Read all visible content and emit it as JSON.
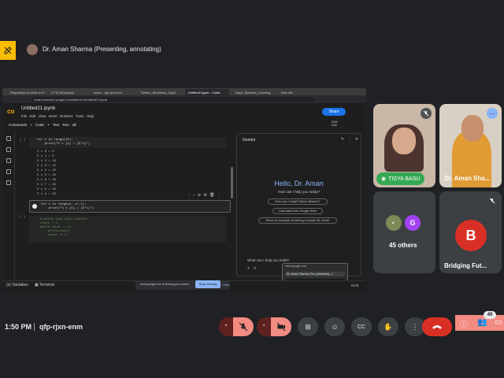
{
  "presenter": {
    "label": "Dr. Aman Sharma (Presenting, annotating)"
  },
  "browser": {
    "tabs": [
      "Regarding no news re th",
      "(774) WhatsApp",
      "Inbox - qfp-rjxn-enm",
      "Python_Workshop_Day1",
      "Untitled2.ipynb - Colab",
      "Day2_Machine_Learning",
      "New tab"
    ],
    "url": "colab.research.google.com/#fileId=1Untitled21.ipynb"
  },
  "colab": {
    "notebook_title": "Untitled21.ipynb",
    "menu": [
      "File",
      "Edit",
      "View",
      "Insert",
      "Runtime",
      "Tools",
      "Help"
    ],
    "toolbar": [
      "Commands",
      "+ Code",
      "+ Text",
      "Run all"
    ],
    "share_label": "Share",
    "ram_label": "RAM\nDisk",
    "cells": [
      {
        "bracket": "[ ]",
        "code": "for i in range(10):\n    print(\"5 x {i} = {5*i}\")",
        "output": "5 x 0 = 0\n5 x 1 = 5\n5 x 2 = 10\n5 x 3 = 15\n5 x 4 = 20\n5 x 5 = 25\n5 x 6 = 30\n5 x 7 = 35\n5 x 8 = 40\n5 x 9 = 45"
      },
      {
        "bracket": "",
        "code": "for i in range(n, n+,t):\n    print(\"5 x {i} = {5*i}\")"
      },
      {
        "bracket": "[ ]",
        "code": "# while loop with counter\ncount = 1\nwhile count <= 5:\n    print(count)\n    count += 1"
      }
    ],
    "status": {
      "variables": "Variables",
      "terminal": "Terminal"
    }
  },
  "gemini": {
    "title": "Gemini",
    "hello": "Hello, Dr. Aman",
    "subtitle": "How can I help you today?",
    "suggestions": [
      "How can I install Python libraries?",
      "Load data from Google Drive",
      "Show an example of training a simple ML model"
    ],
    "prompt": "What can I help you build?"
  },
  "sharing": {
    "text": "meet.google.com is sharing your screen.",
    "stop_label": "Stop sharing",
    "hide_label": "Hide",
    "pip_url": "meet.google.com",
    "pip_tab": "Dr. Aman Sharma (You, presenting...)",
    "side_tag": "en B"
  },
  "participants": {
    "tisya": {
      "name": "TISYA BASU"
    },
    "aman": {
      "name": "Dr. Aman Sha..."
    },
    "others": {
      "label": "45 others",
      "initial": "G"
    },
    "bridging": {
      "name": "Bridging Fut...",
      "initial": "B"
    }
  },
  "meeting": {
    "time": "1:50 PM",
    "code": "qfp-rjxn-enm",
    "participant_count": "49"
  },
  "colors": {
    "hangup": "#d93025",
    "mic_off": "#f28b82",
    "gemini_accent": "#8ab4f8",
    "share": "#1a73e8",
    "tile_b": "#d93025",
    "name_pill": "#34a853"
  }
}
